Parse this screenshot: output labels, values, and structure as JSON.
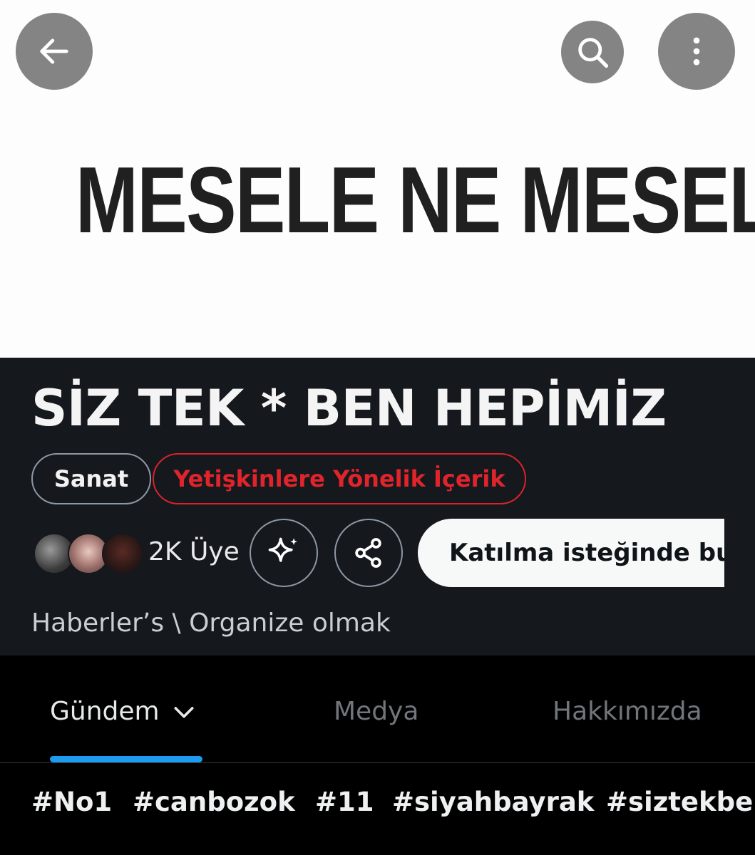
{
  "banner": {
    "text": "MESELE NE MESELA?"
  },
  "top_bar": {
    "back_icon": "arrow-left-icon",
    "search_icon": "search-icon",
    "more_icon": "more-vertical-icon"
  },
  "community": {
    "title": "SİZ TEK * BEN HEPİMİZ",
    "tags": [
      "Sanat",
      "Yetişkinlere Yönelik İçerik"
    ],
    "members": "2K Üye",
    "join_label": "Katılma isteğinde bu",
    "breadcrumb": "Haberler’s \\ Organize olmak"
  },
  "tabs": [
    {
      "label": "Gündem",
      "active": true
    },
    {
      "label": "Medya",
      "active": false
    },
    {
      "label": "Hakkımızda",
      "active": false
    }
  ],
  "hashtags": [
    "#No1",
    "#canbozok",
    "#11",
    "#siyahbayrak",
    "#siztekbe"
  ],
  "colors": {
    "accent": "#1d9bf0",
    "adult_tag": "#e0242c",
    "header_bg": "#15181c"
  }
}
